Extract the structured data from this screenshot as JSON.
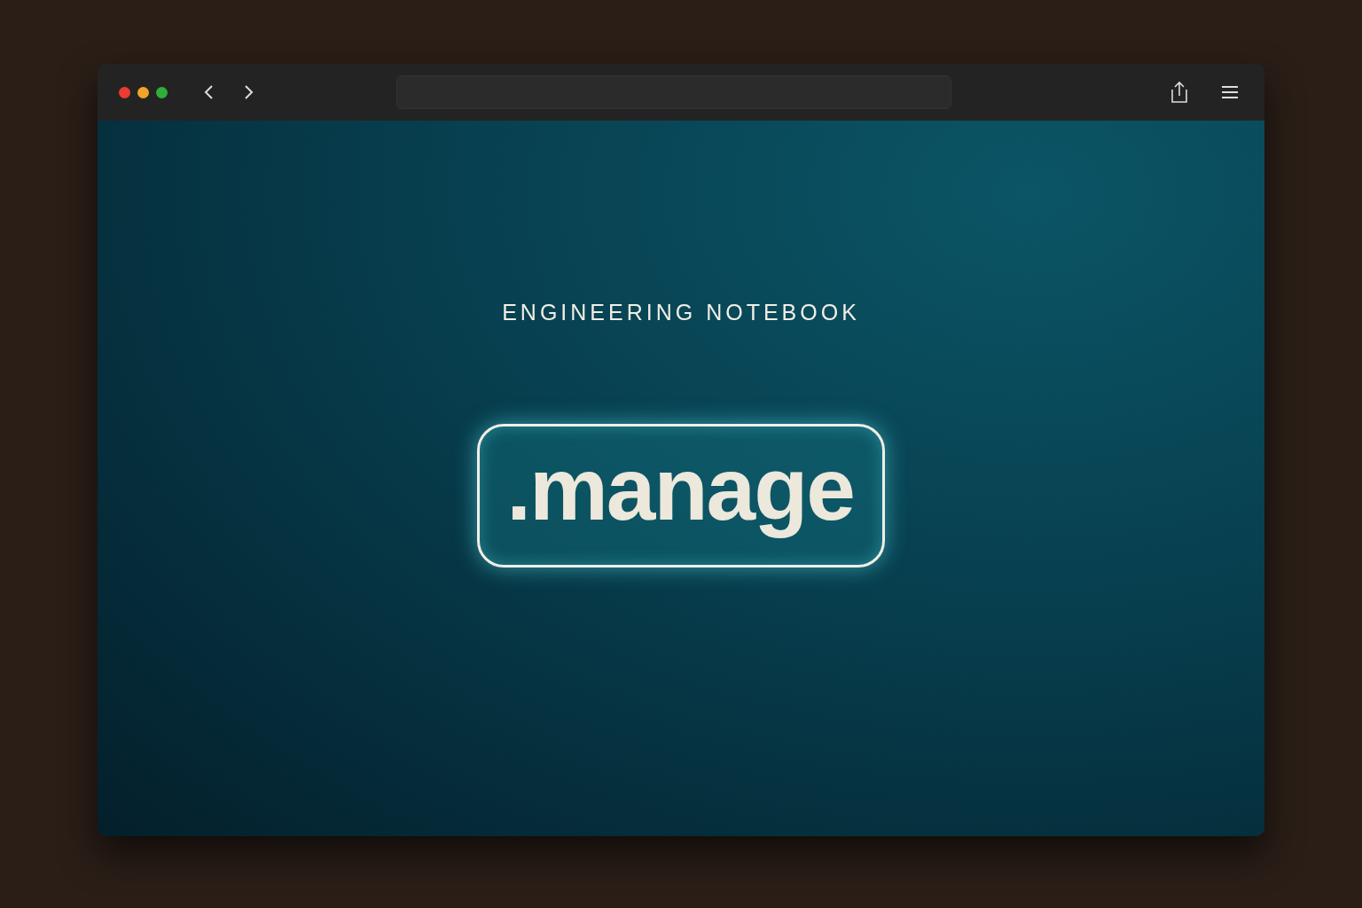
{
  "page": {
    "eyebrow": "ENGINEERING NOTEBOOK",
    "badge": ".manage"
  }
}
